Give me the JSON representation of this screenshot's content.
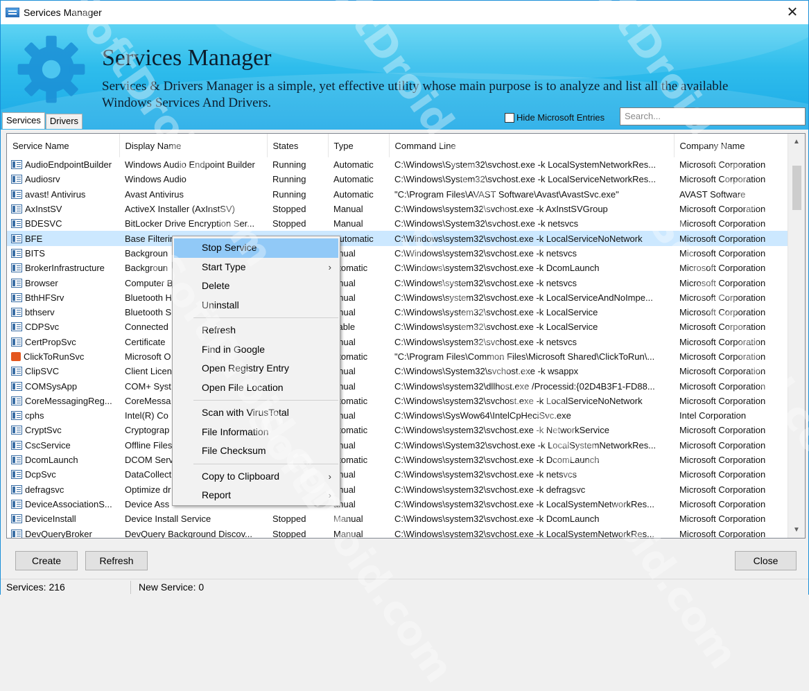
{
  "window": {
    "title": "Services Manager",
    "close_glyph": "✕"
  },
  "banner": {
    "heading": "Services Manager",
    "description": "Services & Drivers Manager is a simple, yet effective utility whose main purpose is to analyze and list all the available Windows Services And Drivers.",
    "hide_ms_label": "Hide Microsoft Entries",
    "hide_ms_checked": false,
    "search_placeholder": "Search..."
  },
  "tabs": [
    "Services",
    "Drivers"
  ],
  "active_tab": "Services",
  "table": {
    "columns": [
      "Service Name",
      "Display Name",
      "States",
      "Type",
      "Command Line",
      "Company Name"
    ],
    "selected_row": 5,
    "rows": [
      [
        "AudioEndpointBuilder",
        "Windows Audio Endpoint Builder",
        "Running",
        "Automatic",
        "C:\\Windows\\System32\\svchost.exe -k LocalSystemNetworkRes...",
        "Microsoft Corporation"
      ],
      [
        "Audiosrv",
        "Windows Audio",
        "Running",
        "Automatic",
        "C:\\Windows\\System32\\svchost.exe -k LocalServiceNetworkRes...",
        "Microsoft Corporation"
      ],
      [
        "avast! Antivirus",
        "Avast Antivirus",
        "Running",
        "Automatic",
        "\"C:\\Program Files\\AVAST Software\\Avast\\AvastSvc.exe\"",
        "AVAST Software"
      ],
      [
        "AxInstSV",
        "ActiveX Installer (AxInstSV)",
        "Stopped",
        "Manual",
        "C:\\Windows\\system32\\svchost.exe -k AxInstSVGroup",
        "Microsoft Corporation"
      ],
      [
        "BDESVC",
        "BitLocker Drive Encryption Ser...",
        "Stopped",
        "Manual",
        "C:\\Windows\\System32\\svchost.exe -k netsvcs",
        "Microsoft Corporation"
      ],
      [
        "BFE",
        "Base Filterin",
        "",
        "Automatic",
        "C:\\Windows\\system32\\svchost.exe -k LocalServiceNoNetwork",
        "Microsoft Corporation"
      ],
      [
        "BITS",
        "Backgroun",
        "",
        "anual",
        "C:\\Windows\\system32\\svchost.exe -k netsvcs",
        "Microsoft Corporation"
      ],
      [
        "BrokerInfrastructure",
        "Backgroun",
        "",
        "utomatic",
        "C:\\Windows\\system32\\svchost.exe -k DcomLaunch",
        "Microsoft Corporation"
      ],
      [
        "Browser",
        "Computer B",
        "",
        "anual",
        "C:\\Windows\\system32\\svchost.exe -k netsvcs",
        "Microsoft Corporation"
      ],
      [
        "BthHFSrv",
        "Bluetooth H",
        "",
        "anual",
        "C:\\Windows\\system32\\svchost.exe -k LocalServiceAndNoImpe...",
        "Microsoft Corporation"
      ],
      [
        "bthserv",
        "Bluetooth S",
        "",
        "anual",
        "C:\\Windows\\system32\\svchost.exe -k LocalService",
        "Microsoft Corporation"
      ],
      [
        "CDPSvc",
        "Connected",
        "",
        "sable",
        "C:\\Windows\\system32\\svchost.exe -k LocalService",
        "Microsoft Corporation"
      ],
      [
        "CertPropSvc",
        "Certificate",
        "",
        "anual",
        "C:\\Windows\\system32\\svchost.exe -k netsvcs",
        "Microsoft Corporation"
      ],
      [
        "ClickToRunSvc",
        "Microsoft O",
        "",
        "utomatic",
        "\"C:\\Program Files\\Common Files\\Microsoft Shared\\ClickToRun\\...",
        "Microsoft Corporation"
      ],
      [
        "ClipSVC",
        "Client Licen",
        "",
        "anual",
        "C:\\Windows\\System32\\svchost.exe -k wsappx",
        "Microsoft Corporation"
      ],
      [
        "COMSysApp",
        "COM+ Syst",
        "",
        "anual",
        "C:\\Windows\\system32\\dllhost.exe /Processid:{02D4B3F1-FD88...",
        "Microsoft Corporation"
      ],
      [
        "CoreMessagingReg...",
        "CoreMessa",
        "",
        "utomatic",
        "C:\\Windows\\system32\\svchost.exe -k LocalServiceNoNetwork",
        "Microsoft Corporation"
      ],
      [
        "cphs",
        "Intel(R) Co",
        "",
        "anual",
        "C:\\Windows\\SysWow64\\IntelCpHeciSvc.exe",
        "Intel Corporation"
      ],
      [
        "CryptSvc",
        "Cryptograp",
        "",
        "utomatic",
        "C:\\Windows\\system32\\svchost.exe -k NetworkService",
        "Microsoft Corporation"
      ],
      [
        "CscService",
        "Offline Files",
        "",
        "anual",
        "C:\\Windows\\System32\\svchost.exe -k LocalSystemNetworkRes...",
        "Microsoft Corporation"
      ],
      [
        "DcomLaunch",
        "DCOM Serv",
        "",
        "utomatic",
        "C:\\Windows\\system32\\svchost.exe -k DcomLaunch",
        "Microsoft Corporation"
      ],
      [
        "DcpSvc",
        "DataCollect",
        "",
        "anual",
        "C:\\Windows\\system32\\svchost.exe -k netsvcs",
        "Microsoft Corporation"
      ],
      [
        "defragsvc",
        "Optimize dr",
        "",
        "anual",
        "C:\\Windows\\system32\\svchost.exe -k defragsvc",
        "Microsoft Corporation"
      ],
      [
        "DeviceAssociationS...",
        "Device Ass",
        "",
        "anual",
        "C:\\Windows\\system32\\svchost.exe -k LocalSystemNetworkRes...",
        "Microsoft Corporation"
      ],
      [
        "DeviceInstall",
        "Device Install Service",
        "Stopped",
        "Manual",
        "C:\\Windows\\system32\\svchost.exe -k DcomLaunch",
        "Microsoft Corporation"
      ],
      [
        "DevQueryBroker",
        "DevQuery Background Discov...",
        "Stopped",
        "Manual",
        "C:\\Windows\\system32\\svchost.exe -k LocalSystemNetworkRes...",
        "Microsoft Corporation"
      ]
    ],
    "row_icons": [
      "service",
      "service",
      "service",
      "service",
      "service",
      "service",
      "service",
      "service",
      "service",
      "service",
      "service",
      "service",
      "service",
      "office",
      "service",
      "service",
      "service",
      "service",
      "service",
      "service",
      "service",
      "service",
      "service",
      "service",
      "service",
      "service"
    ]
  },
  "context_menu": {
    "items": [
      {
        "label": "Stop Service",
        "submenu": false,
        "highlighted": true
      },
      {
        "label": "Start Type",
        "submenu": true
      },
      {
        "label": "Delete",
        "submenu": false
      },
      {
        "label": "Uninstall",
        "submenu": false
      },
      {
        "separator": true
      },
      {
        "label": "Refresh",
        "submenu": false
      },
      {
        "label": "Find in Google",
        "submenu": false
      },
      {
        "label": "Open Registry Entry",
        "submenu": false
      },
      {
        "label": "Open File Location",
        "submenu": false
      },
      {
        "separator": true
      },
      {
        "label": "Scan with VirusTotal",
        "submenu": false
      },
      {
        "label": "File Information",
        "submenu": false
      },
      {
        "label": "File Checksum",
        "submenu": false
      },
      {
        "separator": true
      },
      {
        "label": "Copy to Clipboard",
        "submenu": true
      },
      {
        "label": "Report",
        "submenu": true
      }
    ],
    "arrow_glyph": "›"
  },
  "buttons": {
    "create": "Create",
    "refresh": "Refresh",
    "close": "Close"
  },
  "status": {
    "services": "Services: 216",
    "new_service": "New Service: 0"
  },
  "watermark": "SoftDroid.com",
  "colors": {
    "banner_top": "#5fd3f3",
    "banner_bottom": "#1aa8e6",
    "selection": "#cce8ff",
    "menu_highlight": "#91c9f7"
  }
}
